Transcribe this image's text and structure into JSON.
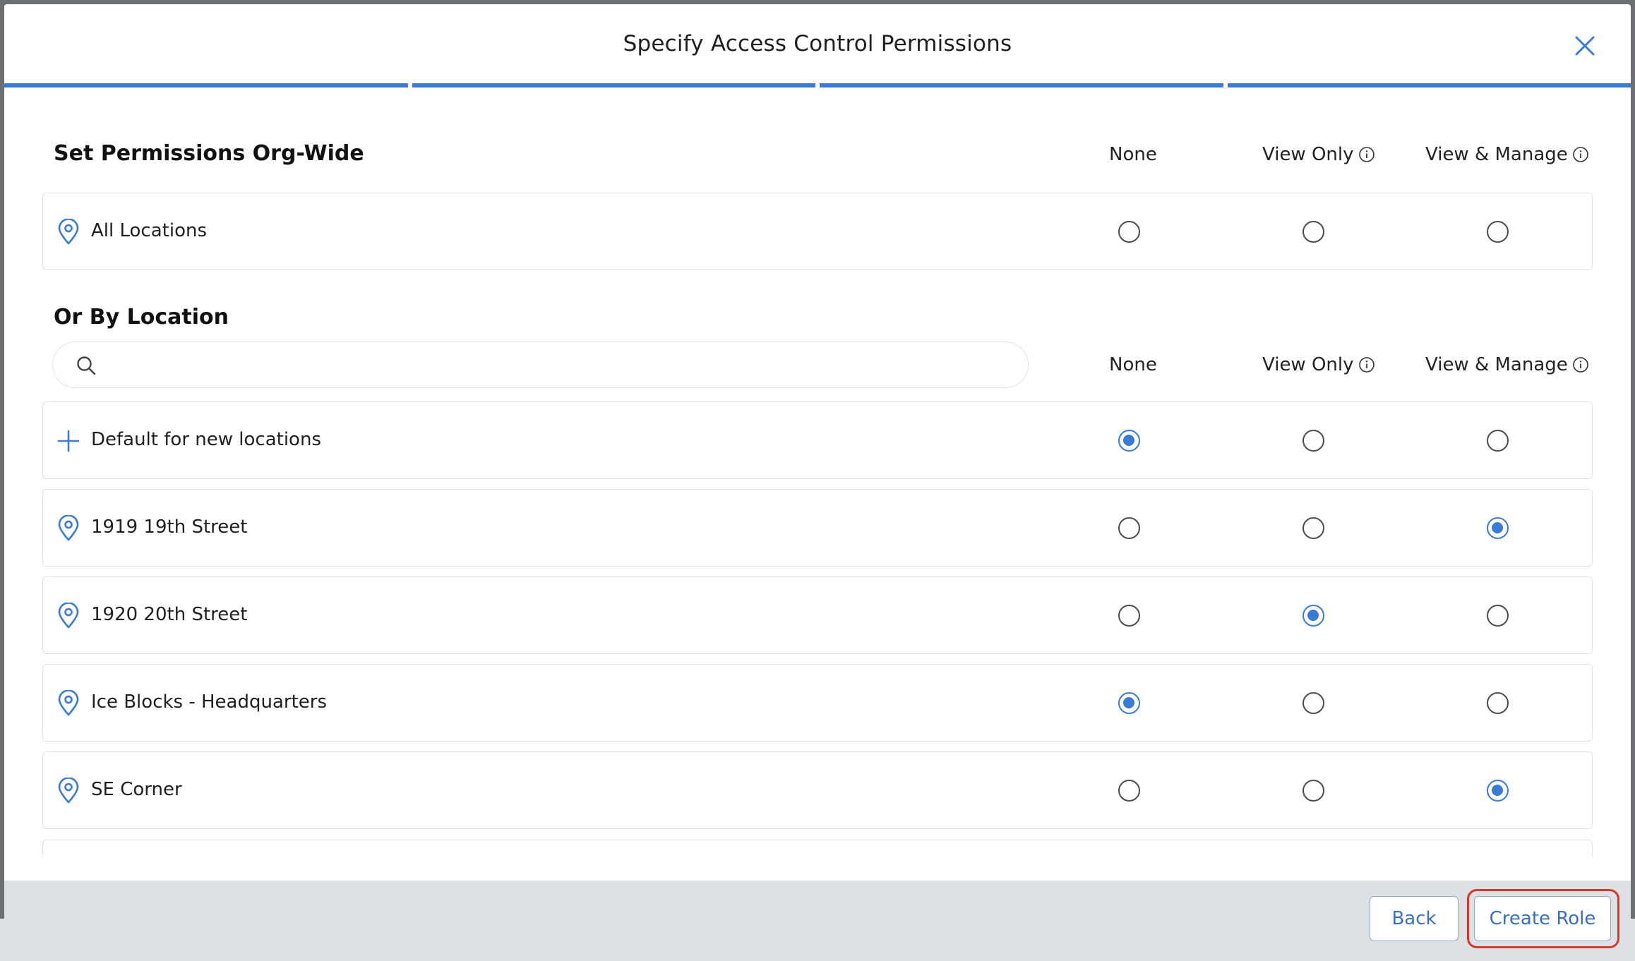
{
  "modal": {
    "title": "Specify Access Control Permissions",
    "progress_steps": 4
  },
  "org_wide": {
    "section_title": "Set Permissions Org-Wide",
    "columns": [
      "None",
      "View Only",
      "View & Manage"
    ],
    "row": {
      "label": "All Locations",
      "icon": "location-pin-icon",
      "selected": null
    }
  },
  "by_location": {
    "section_title": "Or By Location",
    "search": {
      "value": "",
      "placeholder": ""
    },
    "columns": [
      "None",
      "View Only",
      "View & Manage"
    ],
    "rows": [
      {
        "label": "Default for new locations",
        "icon": "plus-icon",
        "selected": "none"
      },
      {
        "label": "1919 19th Street",
        "icon": "location-pin-icon",
        "selected": "manage"
      },
      {
        "label": "1920 20th Street",
        "icon": "location-pin-icon",
        "selected": "view"
      },
      {
        "label": "Ice Blocks - Headquarters",
        "icon": "location-pin-icon",
        "selected": "none"
      },
      {
        "label": "SE Corner",
        "icon": "location-pin-icon",
        "selected": "manage"
      }
    ]
  },
  "footer": {
    "back_label": "Back",
    "create_label": "Create Role"
  },
  "colors": {
    "accent": "#3a7bd5",
    "highlight": "#d93a2b",
    "footer_bg": "#dde1e5"
  }
}
